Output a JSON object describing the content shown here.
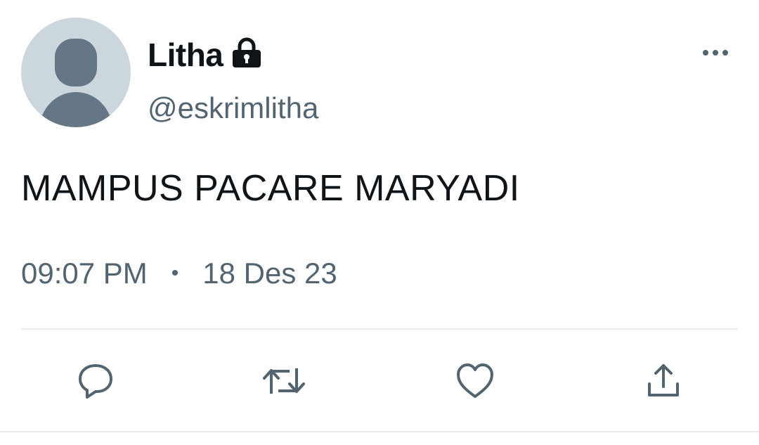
{
  "user": {
    "display_name": "Litha",
    "handle": "@eskrimlitha",
    "protected_icon": "lock-icon",
    "avatar_icon": "default-avatar"
  },
  "tweet": {
    "text": "MAMPUS PACARE MARYADI",
    "time": "09:07 PM",
    "separator": "•",
    "date": "18 Des 23"
  },
  "actions": {
    "reply_icon": "reply-icon",
    "retweet_icon": "retweet-icon",
    "like_icon": "heart-icon",
    "share_icon": "share-icon",
    "more_icon": "more-icon"
  },
  "colors": {
    "text_primary": "#0f1419",
    "text_secondary": "#536471",
    "avatar_bg": "#ccd6dd",
    "avatar_figure": "#657786",
    "divider": "#e6ecf0"
  }
}
